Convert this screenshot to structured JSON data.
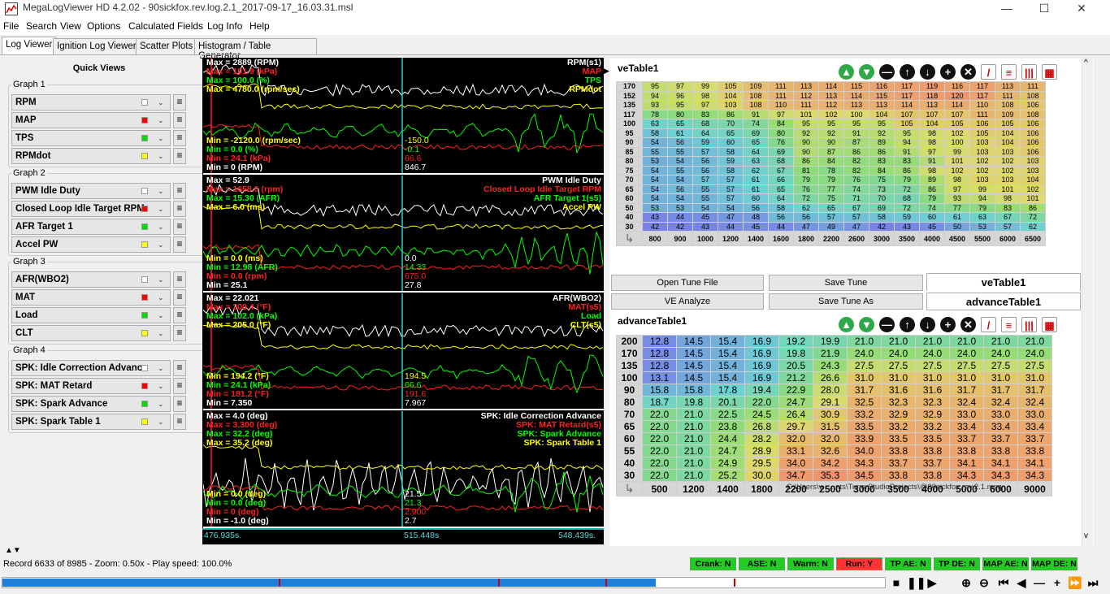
{
  "window": {
    "title": "MegaLogViewer HD 4.2.02 - 90sickfox.rev.log.2.1_2017-09-17_16.03.31.msl",
    "min": "—",
    "max": "☐",
    "close": "✕"
  },
  "menu": [
    "File",
    "Search",
    "View",
    "Options",
    "Calculated Fields",
    "Log Info",
    "Help"
  ],
  "tabs": [
    "Log Viewer",
    "Ignition Log Viewer",
    "Scatter Plots",
    "Histogram / Table Generator"
  ],
  "quick_views": {
    "title": "Quick Views",
    "groups": [
      {
        "label": "Graph 1",
        "items": [
          {
            "name": "RPM",
            "color": "#ffffff"
          },
          {
            "name": "MAP",
            "color": "#ff0000"
          },
          {
            "name": "TPS",
            "color": "#00dd00"
          },
          {
            "name": "RPMdot",
            "color": "#ffff00"
          }
        ]
      },
      {
        "label": "Graph 2",
        "items": [
          {
            "name": "PWM Idle Duty",
            "color": "#ffffff"
          },
          {
            "name": "Closed Loop Idle Target RPM",
            "color": "#ff0000"
          },
          {
            "name": "AFR Target 1",
            "color": "#00dd00"
          },
          {
            "name": "Accel PW",
            "color": "#ffff00"
          }
        ]
      },
      {
        "label": "Graph 3",
        "items": [
          {
            "name": "AFR(WBO2)",
            "color": "#ffffff"
          },
          {
            "name": "MAT",
            "color": "#ff0000"
          },
          {
            "name": "Load",
            "color": "#00dd00"
          },
          {
            "name": "CLT",
            "color": "#ffff00"
          }
        ]
      },
      {
        "label": "Graph 4",
        "items": [
          {
            "name": "SPK: Idle Correction Advance",
            "color": "#ffffff"
          },
          {
            "name": "SPK: MAT Retard",
            "color": "#ff0000"
          },
          {
            "name": "SPK: Spark Advance",
            "color": "#00dd00"
          },
          {
            "name": "SPK: Spark Table 1",
            "color": "#ffff00"
          }
        ]
      }
    ]
  },
  "graphs": [
    {
      "max": [
        {
          "t": "Max = 2889 (RPM)",
          "c": "#ffffff"
        },
        {
          "t": "Max = 101.9 (kPa)",
          "c": "#ff2020"
        },
        {
          "t": "Max = 100.0 (%)",
          "c": "#00ff00"
        },
        {
          "t": "Max = 4780.0 (rpm/sec)",
          "c": "#ffff00"
        }
      ],
      "min": [
        {
          "t": "Min = -2120.0 (rpm/sec)",
          "c": "#ffff00"
        },
        {
          "t": "Min = 0.0 (%)",
          "c": "#00ff00"
        },
        {
          "t": "Min = 24.1 (kPa)",
          "c": "#ff2020"
        },
        {
          "t": "Min = 0 (RPM)",
          "c": "#ffffff"
        }
      ],
      "names": [
        {
          "t": "RPM(s1)",
          "c": "#ffffff"
        },
        {
          "t": "MAP",
          "c": "#ff2020"
        },
        {
          "t": "TPS",
          "c": "#00ff00"
        },
        {
          "t": "RPMdot",
          "c": "#ffff00"
        }
      ],
      "cursor": [
        {
          "t": "-150.0",
          "c": "#ffff00"
        },
        {
          "t": "-0.1",
          "c": "#00ff00"
        },
        {
          "t": "66.6",
          "c": "#ff2020"
        },
        {
          "t": "846.7",
          "c": "#ffffff"
        }
      ]
    },
    {
      "max": [
        {
          "t": "Max = 52.9",
          "c": "#ffffff"
        },
        {
          "t": "Max = 1658.0 (rpm)",
          "c": "#ff2020"
        },
        {
          "t": "Max = 15.30 (AFR)",
          "c": "#00ff00"
        },
        {
          "t": "Max = 6.0 (ms)",
          "c": "#ffff00"
        }
      ],
      "min": [
        {
          "t": "Min = 0.0 (ms)",
          "c": "#ffff00"
        },
        {
          "t": "Min = 12.98 (AFR)",
          "c": "#00ff00"
        },
        {
          "t": "Min = 0.0 (rpm)",
          "c": "#ff2020"
        },
        {
          "t": "Min = 25.1",
          "c": "#ffffff"
        }
      ],
      "names": [
        {
          "t": "PWM Idle Duty",
          "c": "#ffffff"
        },
        {
          "t": "Closed Loop Idle Target RPM",
          "c": "#ff2020"
        },
        {
          "t": "AFR Target 1(s5)",
          "c": "#00ff00"
        },
        {
          "t": "Accel PW",
          "c": "#ffff00"
        }
      ],
      "cursor": [
        {
          "t": "0.0",
          "c": "#ffffff"
        },
        {
          "t": "14.33",
          "c": "#00ff00"
        },
        {
          "t": "675.0",
          "c": "#ff2020"
        },
        {
          "t": "27.8",
          "c": "#ffffff"
        }
      ]
    },
    {
      "max": [
        {
          "t": "Max = 22.021",
          "c": "#ffffff"
        },
        {
          "t": "Max = 200.4 (°F)",
          "c": "#ff2020"
        },
        {
          "t": "Max = 102.0 (kPa)",
          "c": "#00ff00"
        },
        {
          "t": "Max = 205.0 (°F)",
          "c": "#ffff00"
        }
      ],
      "min": [
        {
          "t": "Min = 194.2 (°F)",
          "c": "#ffff00"
        },
        {
          "t": "Min = 24.1 (kPa)",
          "c": "#00ff00"
        },
        {
          "t": "Min = 181.2 (°F)",
          "c": "#ff2020"
        },
        {
          "t": "Min = 7.350",
          "c": "#ffffff"
        }
      ],
      "names": [
        {
          "t": "AFR(WBO2)",
          "c": "#ffffff"
        },
        {
          "t": "MAT(s5)",
          "c": "#ff2020"
        },
        {
          "t": "Load",
          "c": "#00ff00"
        },
        {
          "t": "CLT(s5)",
          "c": "#ffff00"
        }
      ],
      "cursor": [
        {
          "t": "194.5",
          "c": "#ffff00"
        },
        {
          "t": "66.6",
          "c": "#00ff00"
        },
        {
          "t": "191.6",
          "c": "#ff2020"
        },
        {
          "t": "7.967",
          "c": "#ffffff"
        }
      ]
    },
    {
      "max": [
        {
          "t": "Max = 4.0 (deg)",
          "c": "#ffffff"
        },
        {
          "t": "Max = 3.300 (deg)",
          "c": "#ff2020"
        },
        {
          "t": "Max = 32.2 (deg)",
          "c": "#00ff00"
        },
        {
          "t": "Max = 35.2 (deg)",
          "c": "#ffff00"
        }
      ],
      "min": [
        {
          "t": "Min = 0.0 (deg)",
          "c": "#ffff00"
        },
        {
          "t": "Min = 0.0 (deg)",
          "c": "#00ff00"
        },
        {
          "t": "Min = 0 (deg)",
          "c": "#ff2020"
        },
        {
          "t": "Min = -1.0 (deg)",
          "c": "#ffffff"
        }
      ],
      "names": [
        {
          "t": "SPK: Idle Correction Advance",
          "c": "#ffffff"
        },
        {
          "t": "SPK: MAT Retard(s5)",
          "c": "#ff2020"
        },
        {
          "t": "SPK: Spark Advance",
          "c": "#00ff00"
        },
        {
          "t": "SPK: Spark Table 1",
          "c": "#ffff00"
        }
      ],
      "cursor": [
        {
          "t": "21.5",
          "c": "#ffffff"
        },
        {
          "t": "21.3",
          "c": "#00ff00"
        },
        {
          "t": "2.900",
          "c": "#ff2020"
        },
        {
          "t": "2.7",
          "c": "#ffffff"
        }
      ]
    }
  ],
  "timeline": {
    "left": "476.935s.",
    "mid": "515.448s",
    "right": "548.439s."
  },
  "ve": {
    "title": "veTable1",
    "rows": [
      "170",
      "152",
      "135",
      "117",
      "100",
      "95",
      "90",
      "85",
      "80",
      "75",
      "70",
      "65",
      "60",
      "50",
      "40",
      "30"
    ],
    "cols": [
      "800",
      "900",
      "1000",
      "1200",
      "1400",
      "1600",
      "1800",
      "2200",
      "2600",
      "3000",
      "3500",
      "4000",
      "4500",
      "5500",
      "6000",
      "6500"
    ],
    "values": [
      [
        "95",
        "97",
        "99",
        "105",
        "109",
        "111",
        "113",
        "114",
        "115",
        "116",
        "117",
        "119",
        "116",
        "117",
        "113",
        "111"
      ],
      [
        "94",
        "96",
        "98",
        "104",
        "108",
        "111",
        "112",
        "113",
        "114",
        "115",
        "117",
        "118",
        "120",
        "117",
        "111",
        "108"
      ],
      [
        "93",
        "95",
        "97",
        "103",
        "108",
        "110",
        "111",
        "112",
        "113",
        "113",
        "114",
        "113",
        "114",
        "110",
        "108",
        "106"
      ],
      [
        "78",
        "80",
        "83",
        "86",
        "91",
        "97",
        "101",
        "102",
        "100",
        "104",
        "107",
        "107",
        "107",
        "111",
        "109",
        "108"
      ],
      [
        "63",
        "65",
        "68",
        "70",
        "74",
        "84",
        "95",
        "95",
        "95",
        "95",
        "105",
        "104",
        "105",
        "106",
        "105",
        "106"
      ],
      [
        "58",
        "61",
        "64",
        "65",
        "69",
        "80",
        "92",
        "92",
        "91",
        "92",
        "95",
        "98",
        "102",
        "105",
        "104",
        "106"
      ],
      [
        "54",
        "56",
        "59",
        "60",
        "65",
        "76",
        "90",
        "90",
        "87",
        "89",
        "94",
        "98",
        "100",
        "103",
        "104",
        "106"
      ],
      [
        "55",
        "55",
        "57",
        "58",
        "64",
        "69",
        "90",
        "87",
        "86",
        "86",
        "91",
        "97",
        "99",
        "103",
        "103",
        "106"
      ],
      [
        "53",
        "54",
        "56",
        "59",
        "63",
        "68",
        "86",
        "84",
        "82",
        "83",
        "83",
        "91",
        "101",
        "102",
        "102",
        "103"
      ],
      [
        "54",
        "55",
        "56",
        "58",
        "62",
        "67",
        "81",
        "78",
        "82",
        "84",
        "86",
        "98",
        "102",
        "102",
        "102",
        "103"
      ],
      [
        "54",
        "54",
        "57",
        "57",
        "61",
        "66",
        "79",
        "79",
        "76",
        "75",
        "79",
        "89",
        "98",
        "103",
        "103",
        "104"
      ],
      [
        "54",
        "56",
        "55",
        "57",
        "61",
        "65",
        "76",
        "77",
        "74",
        "73",
        "72",
        "86",
        "97",
        "99",
        "101",
        "102"
      ],
      [
        "54",
        "54",
        "55",
        "57",
        "60",
        "64",
        "72",
        "75",
        "71",
        "70",
        "68",
        "79",
        "93",
        "94",
        "98",
        "101"
      ],
      [
        "53",
        "53",
        "54",
        "54",
        "56",
        "58",
        "62",
        "65",
        "67",
        "69",
        "72",
        "74",
        "77",
        "79",
        "83",
        "86"
      ],
      [
        "43",
        "44",
        "45",
        "47",
        "48",
        "56",
        "56",
        "57",
        "57",
        "58",
        "59",
        "60",
        "61",
        "63",
        "67",
        "72"
      ],
      [
        "42",
        "42",
        "43",
        "44",
        "45",
        "44",
        "47",
        "49",
        "47",
        "42",
        "43",
        "45",
        "50",
        "53",
        "57",
        "62"
      ]
    ]
  },
  "buttons": {
    "open_tune": "Open Tune File",
    "save_tune": "Save Tune",
    "ve_analyze": "VE Analyze",
    "save_tune_as": "Save Tune As"
  },
  "table_list": [
    "veTable1",
    "advanceTable1"
  ],
  "adv": {
    "title": "advanceTable1",
    "rows": [
      "200",
      "170",
      "135",
      "100",
      "90",
      "80",
      "70",
      "65",
      "60",
      "55",
      "40",
      "30"
    ],
    "cols": [
      "500",
      "1200",
      "1400",
      "1800",
      "2200",
      "2500",
      "3000",
      "3500",
      "4000",
      "5000",
      "6000",
      "9000"
    ],
    "values": [
      [
        "12.8",
        "14.5",
        "15.4",
        "16.9",
        "19.2",
        "19.9",
        "21.0",
        "21.0",
        "21.0",
        "21.0",
        "21.0",
        "21.0"
      ],
      [
        "12.8",
        "14.5",
        "15.4",
        "16.9",
        "19.8",
        "21.9",
        "24.0",
        "24.0",
        "24.0",
        "24.0",
        "24.0",
        "24.0"
      ],
      [
        "12.8",
        "14.5",
        "15.4",
        "16.9",
        "20.5",
        "24.3",
        "27.5",
        "27.5",
        "27.5",
        "27.5",
        "27.5",
        "27.5"
      ],
      [
        "13.1",
        "14.5",
        "15.4",
        "16.9",
        "21.2",
        "26.6",
        "31.0",
        "31.0",
        "31.0",
        "31.0",
        "31.0",
        "31.0"
      ],
      [
        "15.8",
        "15.8",
        "17.8",
        "19.4",
        "22.9",
        "28.0",
        "31.7",
        "31.6",
        "31.6",
        "31.7",
        "31.7",
        "31.7"
      ],
      [
        "18.7",
        "19.8",
        "20.1",
        "22.0",
        "24.7",
        "29.1",
        "32.5",
        "32.3",
        "32.3",
        "32.4",
        "32.4",
        "32.4"
      ],
      [
        "22.0",
        "21.0",
        "22.5",
        "24.5",
        "26.4",
        "30.9",
        "33.2",
        "32.9",
        "32.9",
        "33.0",
        "33.0",
        "33.0"
      ],
      [
        "22.0",
        "21.0",
        "23.8",
        "26.8",
        "29.7",
        "31.5",
        "33.5",
        "33.2",
        "33.2",
        "33.4",
        "33.4",
        "33.4"
      ],
      [
        "22.0",
        "21.0",
        "24.4",
        "28.2",
        "32.0",
        "32.0",
        "33.9",
        "33.5",
        "33.5",
        "33.7",
        "33.7",
        "33.7"
      ],
      [
        "22.0",
        "21.0",
        "24.7",
        "28.9",
        "33.1",
        "32.6",
        "34.0",
        "33.8",
        "33.8",
        "33.8",
        "33.8",
        "33.8"
      ],
      [
        "22.0",
        "21.0",
        "24.9",
        "29.5",
        "34.0",
        "34.2",
        "34.3",
        "33.7",
        "33.7",
        "34.1",
        "34.1",
        "34.1"
      ],
      [
        "22.0",
        "21.0",
        "25.2",
        "30.0",
        "34.7",
        "35.3",
        "34.5",
        "33.8",
        "33.8",
        "34.3",
        "34.3",
        "34.3"
      ]
    ]
  },
  "tune_path": "C:\\Users\\v .... nts\\TunerStudioProjects\\@90sickfox.rev.2.1.msq",
  "status": {
    "record": "Record 6633 of 8985 - Zoom: 0.50x - Play speed: 100.0%",
    "indicators": [
      {
        "t": "Crank: N",
        "c": "#22cc22"
      },
      {
        "t": "ASE: N",
        "c": "#22cc22"
      },
      {
        "t": "Warm: N",
        "c": "#22cc22"
      },
      {
        "t": "Run: Y",
        "c": "#ff3333"
      },
      {
        "t": "TP AE: N",
        "c": "#22cc22"
      },
      {
        "t": "TP DE: N",
        "c": "#22cc22"
      },
      {
        "t": "MAP AE: N",
        "c": "#22cc22"
      },
      {
        "t": "MAP DE: N",
        "c": "#22cc22"
      }
    ]
  },
  "playback": {
    "progress": 0.74
  }
}
